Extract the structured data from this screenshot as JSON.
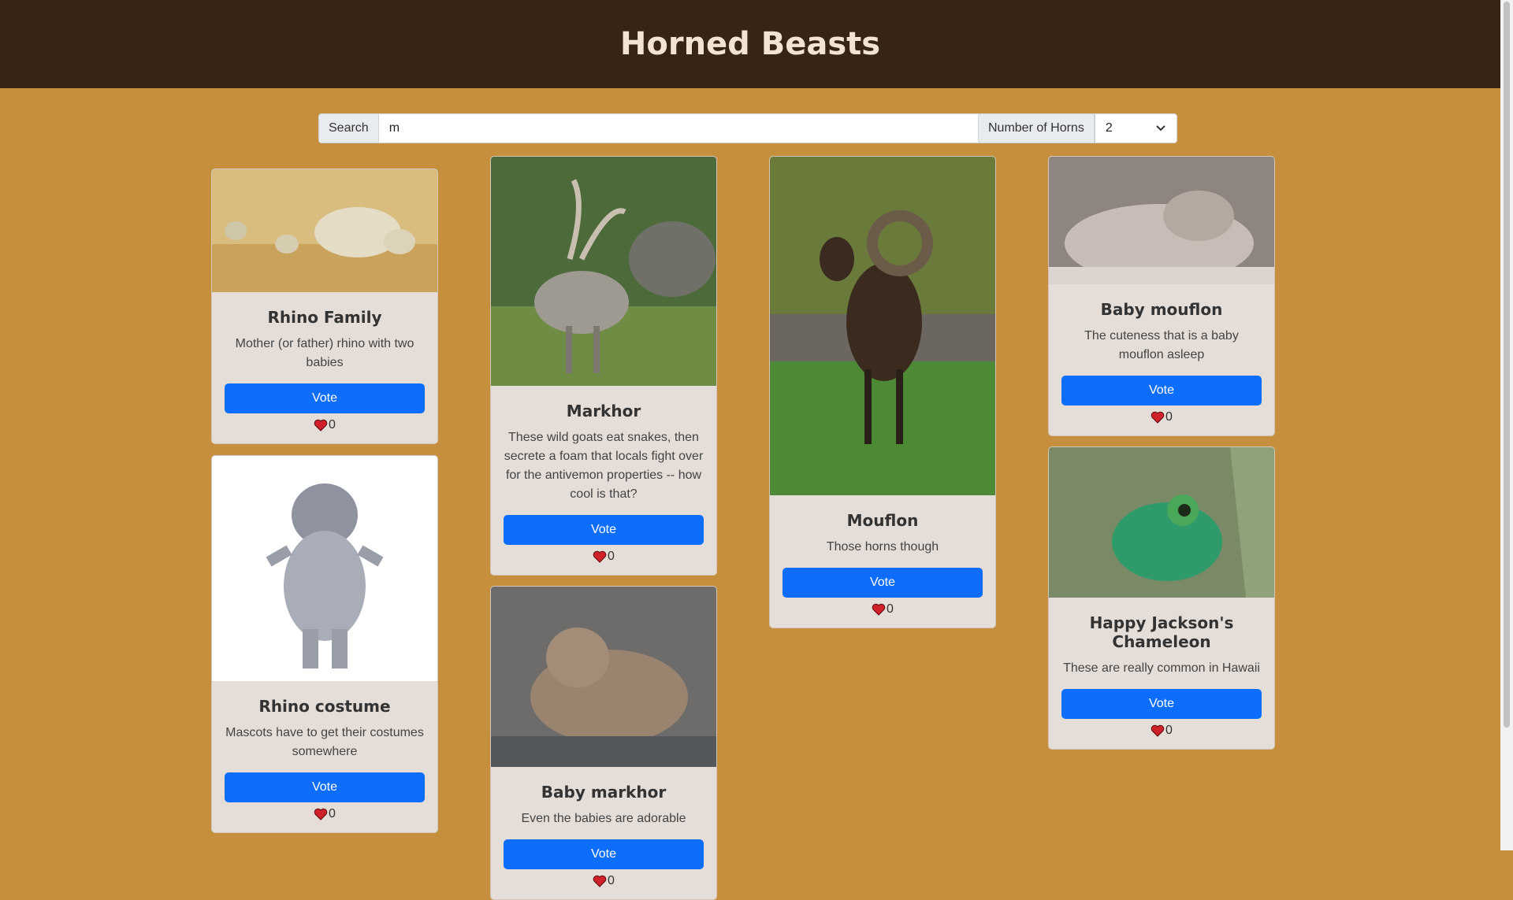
{
  "header": {
    "title": "Horned Beasts"
  },
  "search": {
    "label": "Search",
    "value": "m"
  },
  "horns_filter": {
    "label": "Number of Horns",
    "selected": "2"
  },
  "vote_label": "Vote",
  "beasts": [
    {
      "title": "Rhino Family",
      "description": "Mother (or father) rhino with two babies",
      "votes": "0"
    },
    {
      "title": "Markhor",
      "description": "These wild goats eat snakes, then secrete a foam that locals fight over for the antivemon properties -- how cool is that?",
      "votes": "0"
    },
    {
      "title": "Mouflon",
      "description": "Those horns though",
      "votes": "0"
    },
    {
      "title": "Baby mouflon",
      "description": "The cuteness that is a baby mouflon asleep",
      "votes": "0"
    },
    {
      "title": "Rhino costume",
      "description": "Mascots have to get their costumes somewhere",
      "votes": "0"
    },
    {
      "title": "Baby markhor",
      "description": "Even the babies are adorable",
      "votes": "0"
    },
    {
      "title": "Happy Jackson's Chameleon",
      "description": "These are really common in Hawaii",
      "votes": "0"
    }
  ],
  "colors": {
    "header_bg": "#362416",
    "page_bg": "#c68f3e",
    "button": "#0d6efd",
    "card_bg": "#e5ddd7"
  }
}
